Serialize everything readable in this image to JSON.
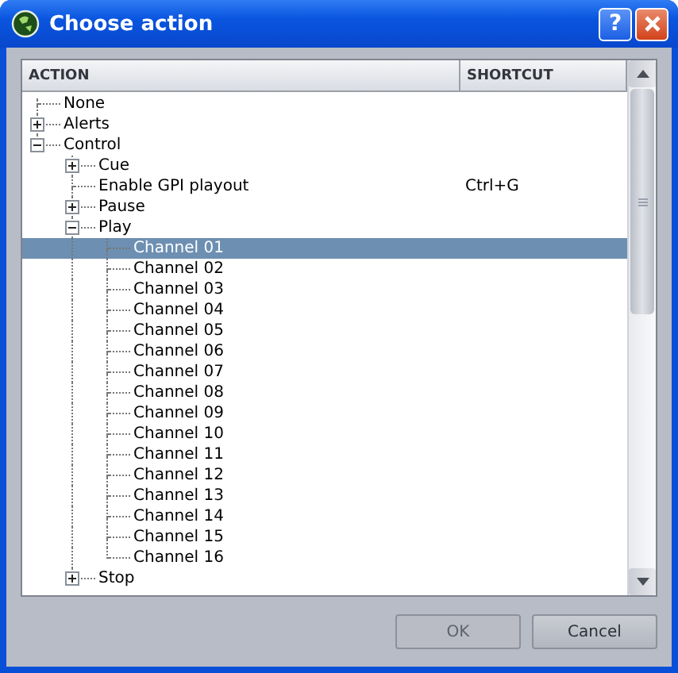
{
  "window": {
    "title": "Choose action",
    "help_button": "?"
  },
  "tree": {
    "columns": [
      "ACTION",
      "SHORTCUT"
    ],
    "items": [
      {
        "label": "None",
        "selected": false
      },
      {
        "label": "Alerts",
        "expanded": false,
        "selected": false
      },
      {
        "label": "Control",
        "expanded": true,
        "selected": false,
        "children": [
          {
            "label": "Cue",
            "expanded": false,
            "selected": false
          },
          {
            "label": "Enable GPI playout",
            "shortcut": "Ctrl+G",
            "selected": false
          },
          {
            "label": "Pause",
            "expanded": false,
            "selected": false
          },
          {
            "label": "Play",
            "expanded": true,
            "selected": false,
            "children": [
              {
                "label": "Channel 01",
                "selected": true
              },
              {
                "label": "Channel 02",
                "selected": false
              },
              {
                "label": "Channel 03",
                "selected": false
              },
              {
                "label": "Channel 04",
                "selected": false
              },
              {
                "label": "Channel 05",
                "selected": false
              },
              {
                "label": "Channel 06",
                "selected": false
              },
              {
                "label": "Channel 07",
                "selected": false
              },
              {
                "label": "Channel 08",
                "selected": false
              },
              {
                "label": "Channel 09",
                "selected": false
              },
              {
                "label": "Channel 10",
                "selected": false
              },
              {
                "label": "Channel 11",
                "selected": false
              },
              {
                "label": "Channel 12",
                "selected": false
              },
              {
                "label": "Channel 13",
                "selected": false
              },
              {
                "label": "Channel 14",
                "selected": false
              },
              {
                "label": "Channel 15",
                "selected": false
              },
              {
                "label": "Channel 16",
                "selected": false
              }
            ]
          },
          {
            "label": "Stop",
            "expanded": false,
            "selected": false
          }
        ]
      }
    ]
  },
  "buttons": [
    {
      "label": "OK",
      "disabled": true
    },
    {
      "label": "Cancel",
      "disabled": false
    }
  ]
}
